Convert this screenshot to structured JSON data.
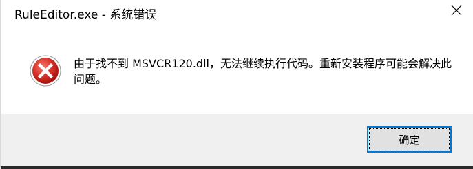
{
  "window": {
    "title": "RuleEditor.exe - 系统错误",
    "close_icon": "close-icon"
  },
  "error": {
    "icon": "error-icon",
    "message": "由于找不到 MSVCR120.dll，无法继续执行代码。重新安装程序可能会解决此问题。"
  },
  "buttons": {
    "ok_label": "确定"
  },
  "colors": {
    "error_red": "#d9342b",
    "button_focus_border": "#0078d7",
    "footer_bg": "#f0f0f0"
  }
}
